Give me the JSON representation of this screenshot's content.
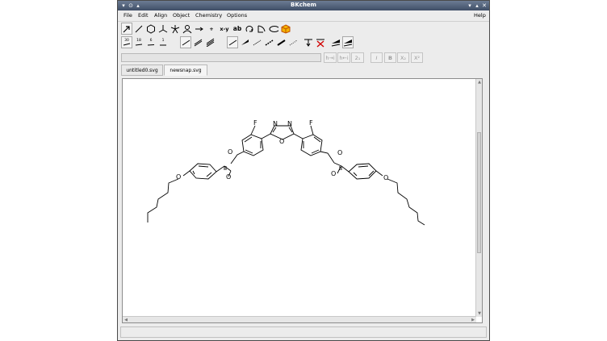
{
  "window": {
    "title": "BKchem"
  },
  "menu": {
    "items": [
      "File",
      "Edit",
      "Align",
      "Object",
      "Chemistry",
      "Options"
    ],
    "help": "Help"
  },
  "toolbar": {
    "modes": [
      "arrow-mode",
      "bond-mode",
      "ring-mode",
      "fragment-mode",
      "template-mode",
      "atom-mode",
      "plus-mode",
      "xy-mode",
      "text-mode",
      "rotate-mode",
      "bracket-mode",
      "vector-mode",
      "mark-mode"
    ],
    "xy_label": "x-y",
    "text_label": "ab",
    "plus_label": "+",
    "angles": [
      "30",
      "18",
      "6",
      "1"
    ],
    "bold_label": "B",
    "italic_label": "I",
    "subscript_label": "X₂",
    "superscript_label": "X²",
    "charge_label": "2₁",
    "hydrogen_left": "h→i",
    "hydrogen_right": "h←i"
  },
  "text_entry": {
    "value": ""
  },
  "tabs": [
    {
      "label": "untitled0.svg",
      "active": false
    },
    {
      "label": "newsnap.svg",
      "active": true
    }
  ],
  "molecule": {
    "atoms": {
      "fluorine": "F",
      "nitrogen": "N",
      "oxygen": "O"
    }
  },
  "scroll": {
    "vertical": 0.45,
    "horizontal": 0.0
  }
}
